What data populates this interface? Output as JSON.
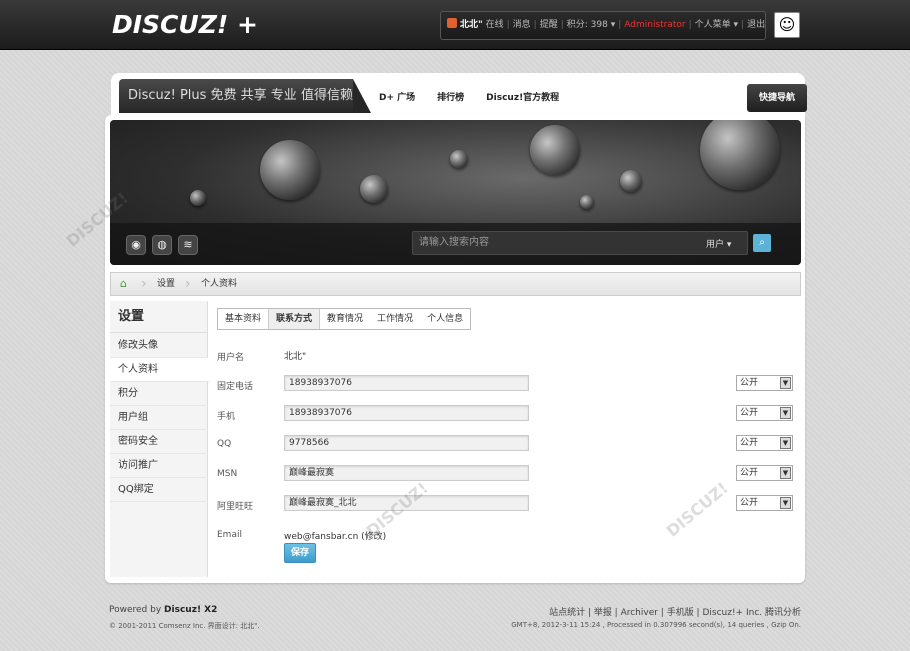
{
  "topbar": {
    "logo": "DISCUZ! +",
    "username": "北北\"",
    "status": "在线",
    "links": [
      "消息",
      "提醒"
    ],
    "points": "积分: 398 ▾",
    "role": "Administrator",
    "personal_menu": "个人菜单 ▾",
    "logout": "退出"
  },
  "nav": {
    "slogan": "Discuz! Plus 免费 共享 专业 值得信赖",
    "links": [
      "D+ 广场",
      "排行榜",
      "Discuz!官方教程"
    ],
    "quick_nav": "快捷导航"
  },
  "search": {
    "placeholder": "请输入搜索内容",
    "type": "用户 ▾"
  },
  "breadcrumb": [
    "设置",
    "个人资料"
  ],
  "sidebar": {
    "title": "设置",
    "items": [
      "修改头像",
      "个人资料",
      "积分",
      "用户组",
      "密码安全",
      "访问推广",
      "QQ绑定"
    ]
  },
  "tabs": [
    "基本资料",
    "联系方式",
    "教育情况",
    "工作情况",
    "个人信息"
  ],
  "form": {
    "username_label": "用户名",
    "username_value": "北北\"",
    "rows": [
      {
        "label": "固定电话",
        "value": "18938937076",
        "privacy": "公开"
      },
      {
        "label": "手机",
        "value": "18938937076",
        "privacy": "公开"
      },
      {
        "label": "QQ",
        "value": "9778566",
        "privacy": "公开"
      },
      {
        "label": "MSN",
        "value": "巅峰最寂寞",
        "privacy": "公开"
      },
      {
        "label": "阿里旺旺",
        "value": "巅峰最寂寞_北北",
        "privacy": "公开"
      }
    ],
    "email_label": "Email",
    "email_value": "web@fansbar.cn (修改)",
    "save": "保存"
  },
  "footer": {
    "powered": "Powered by",
    "brand": "Discuz! X2",
    "copyright": "© 2001-2011 Comsenz Inc. 界面设计: 北北\".",
    "links": "站点统计 | 举报 | Archiver | 手机版 | Discuz!+ Inc.  腾讯分析",
    "info": "GMT+8, 2012-3-11 15:24 , Processed in 0.307996 second(s), 14 queries , Gzip On."
  }
}
